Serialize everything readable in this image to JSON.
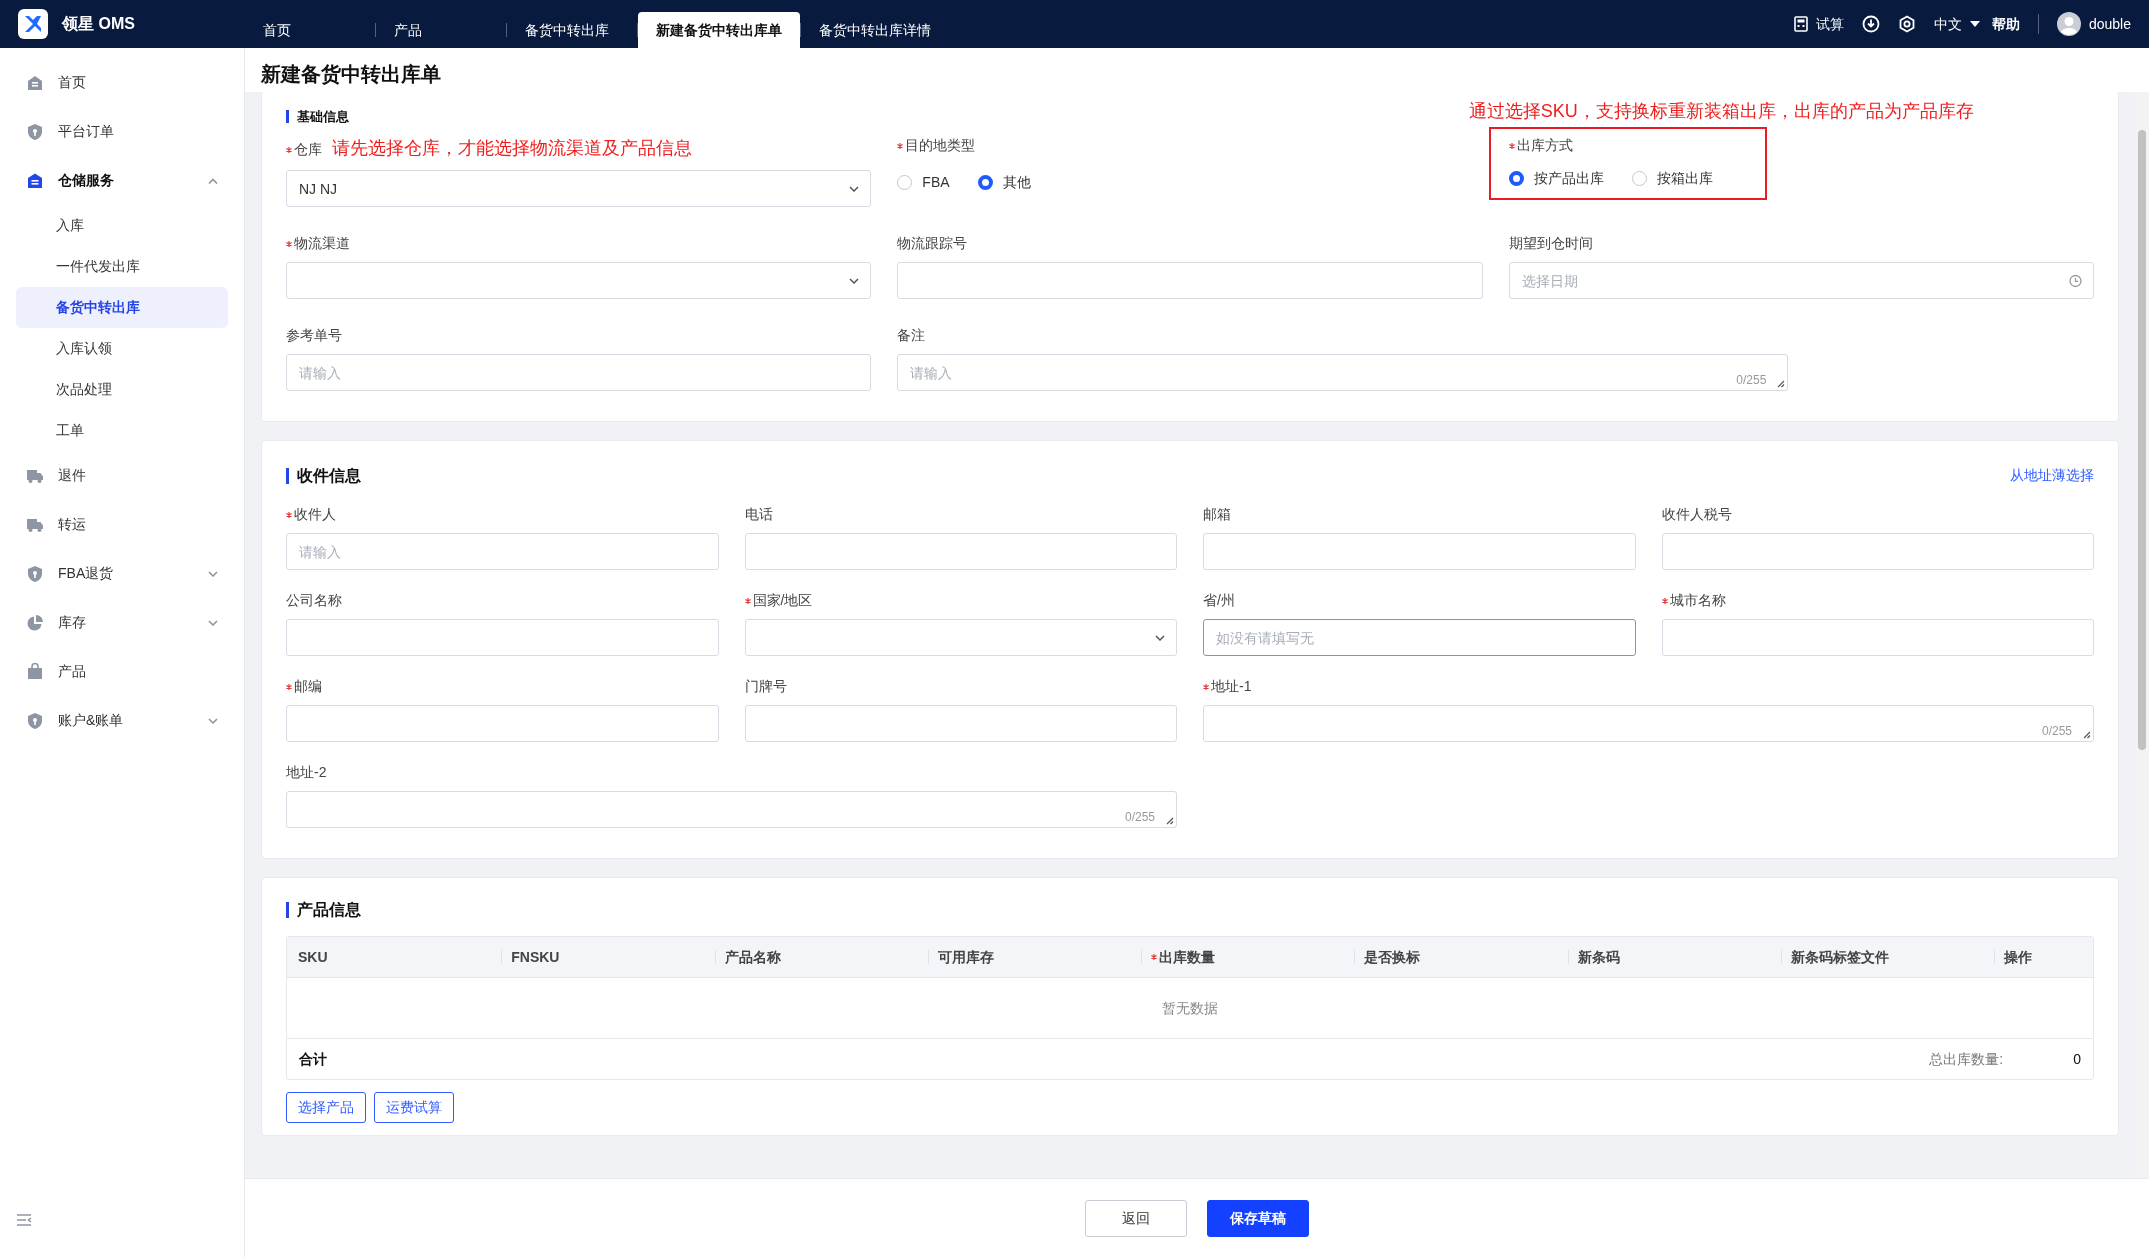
{
  "app": {
    "name": "领星 OMS"
  },
  "tabs": [
    {
      "label": "首页",
      "selected": false
    },
    {
      "label": "产品",
      "selected": false
    },
    {
      "label": "备货中转出库",
      "selected": false
    },
    {
      "label": "新建备货中转出库单",
      "selected": true
    },
    {
      "label": "备货中转出库详情",
      "selected": false
    }
  ],
  "header_actions": {
    "calculator": "试算",
    "language": "中文",
    "help": "帮助",
    "user": "double"
  },
  "sidebar": {
    "items": [
      {
        "label": "首页",
        "selected": false
      },
      {
        "label": "平台订单",
        "selected": false
      },
      {
        "label": "仓储服务",
        "selected": true,
        "expanded": true,
        "children": [
          {
            "label": "入库",
            "selected": false
          },
          {
            "label": "一件代发出库",
            "selected": false
          },
          {
            "label": "备货中转出库",
            "selected": true
          },
          {
            "label": "入库认领",
            "selected": false
          },
          {
            "label": "次品处理",
            "selected": false
          },
          {
            "label": "工单",
            "selected": false
          }
        ]
      },
      {
        "label": "退件",
        "selected": false
      },
      {
        "label": "转运",
        "selected": false
      },
      {
        "label": "FBA退货",
        "selected": false,
        "expanded": false
      },
      {
        "label": "库存",
        "selected": false,
        "expanded": false
      },
      {
        "label": "产品",
        "selected": false
      },
      {
        "label": "账户&账单",
        "selected": false,
        "expanded": false
      }
    ]
  },
  "page_title": "新建备货中转出库单",
  "basic_info": {
    "title": "基础信息",
    "fields": [
      {
        "kind": "select",
        "label": "仓库",
        "required": true,
        "value": "NJ NJ",
        "note": "请先选择仓库，才能选择物流渠道及产品信息"
      },
      {
        "kind": "radio",
        "label": "目的地类型",
        "required": true,
        "options": [
          {
            "label": "FBA",
            "selected": false
          },
          {
            "label": "其他",
            "selected": true
          }
        ]
      },
      {
        "kind": "radio",
        "label": "出库方式",
        "required": true,
        "highlighted": true,
        "note": "通过选择SKU，支持换标重新装箱出库，出库的产品为产品库存",
        "options": [
          {
            "label": "按产品出库",
            "selected": true
          },
          {
            "label": "按箱出库",
            "selected": false
          }
        ]
      },
      {
        "kind": "select",
        "label": "物流渠道",
        "required": true
      },
      {
        "kind": "input",
        "label": "物流跟踪号",
        "required": false
      },
      {
        "kind": "date",
        "label": "期望到仓时间",
        "required": false,
        "placeholder": "选择日期"
      },
      {
        "kind": "input",
        "label": "参考单号",
        "required": false,
        "placeholder": "请输入"
      },
      {
        "kind": "textarea",
        "label": "备注",
        "required": false,
        "placeholder": "请输入",
        "counter": "0/255"
      }
    ]
  },
  "recipient_info": {
    "title": "收件信息",
    "link": "从地址薄选择",
    "fields": [
      {
        "kind": "input",
        "label": "收件人",
        "required": true,
        "placeholder": "请输入"
      },
      {
        "kind": "input",
        "label": "电话",
        "required": false
      },
      {
        "kind": "input",
        "label": "邮箱",
        "required": false
      },
      {
        "kind": "input",
        "label": "收件人税号",
        "required": false
      },
      {
        "kind": "input",
        "label": "公司名称",
        "required": false
      },
      {
        "kind": "select",
        "label": "国家/地区",
        "required": true
      },
      {
        "kind": "input",
        "label": "省/州",
        "required": false,
        "placeholder": "如没有请填写无",
        "focused": true
      },
      {
        "kind": "input",
        "label": "城市名称",
        "required": true
      },
      {
        "kind": "input",
        "label": "邮编",
        "required": true
      },
      {
        "kind": "input",
        "label": "门牌号",
        "required": false
      },
      {
        "kind": "textarea",
        "label": "地址-1",
        "required": true,
        "counter": "0/255"
      },
      {
        "kind": "textarea",
        "label": "地址-2",
        "required": false,
        "counter": "0/255"
      }
    ]
  },
  "product_info": {
    "title": "产品信息",
    "table": {
      "columns": [
        {
          "label": "SKU",
          "required": false
        },
        {
          "label": "FNSKU",
          "required": false
        },
        {
          "label": "产品名称",
          "required": false
        },
        {
          "label": "可用库存",
          "required": false
        },
        {
          "label": "出库数量",
          "required": true
        },
        {
          "label": "是否换标",
          "required": false
        },
        {
          "label": "新条码",
          "required": false
        },
        {
          "label": "新条码标签文件",
          "required": false
        },
        {
          "label": "操作",
          "required": false
        }
      ],
      "empty_text": "暂无数据",
      "total_label": "合计",
      "total_qty_label": "总出库数量:",
      "total_qty": "0"
    },
    "buttons": [
      "选择产品",
      "运费试算"
    ]
  },
  "footer_buttons": [
    {
      "label": "返回",
      "kind": "secondary"
    },
    {
      "label": "保存草稿",
      "kind": "primary"
    }
  ]
}
